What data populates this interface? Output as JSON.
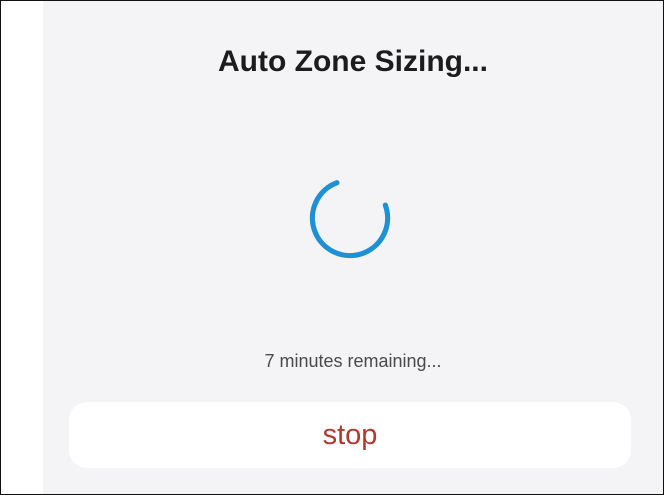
{
  "dialog": {
    "title": "Auto Zone Sizing...",
    "spinner_icon": "loading-spinner-icon",
    "status": "7 minutes remaining...",
    "stop_label": "stop"
  },
  "colors": {
    "accent": "#1e90d6",
    "stop_text": "#b03a30",
    "panel_background": "#f4f4f7"
  }
}
